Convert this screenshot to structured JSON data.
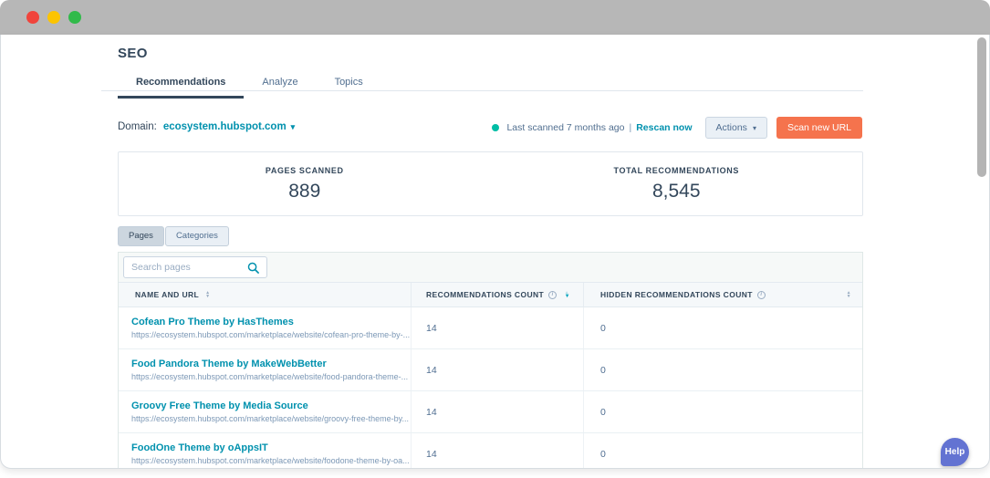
{
  "window_chrome": {
    "traffic_lights": [
      "close",
      "minimize",
      "zoom"
    ]
  },
  "header": {
    "title": "SEO",
    "tabs": [
      {
        "label": "Recommendations",
        "active": true
      },
      {
        "label": "Analyze",
        "active": false
      },
      {
        "label": "Topics",
        "active": false
      }
    ]
  },
  "toolbar": {
    "domain_label": "Domain:",
    "domain_value": "ecosystem.hubspot.com",
    "last_scanned": "Last scanned 7 months ago",
    "separator": "|",
    "rescan_label": "Rescan now",
    "actions_label": "Actions",
    "scan_new_url_label": "Scan new URL"
  },
  "stats": [
    {
      "label": "PAGES SCANNED",
      "value": "889"
    },
    {
      "label": "TOTAL RECOMMENDATIONS",
      "value": "8,545"
    }
  ],
  "view_toggle": [
    {
      "label": "Pages",
      "active": true
    },
    {
      "label": "Categories",
      "active": false
    }
  ],
  "search": {
    "placeholder": "Search pages"
  },
  "table": {
    "columns": [
      {
        "label": "NAME AND URL",
        "info": false,
        "sort": "inactive"
      },
      {
        "label": "RECOMMENDATIONS COUNT",
        "info": true,
        "sort": "desc"
      },
      {
        "label": "HIDDEN RECOMMENDATIONS COUNT",
        "info": true,
        "sort": "inactive"
      }
    ],
    "rows": [
      {
        "name": "Cofean Pro Theme by HasThemes",
        "url": "https://ecosystem.hubspot.com/marketplace/website/cofean-pro-theme-by-...",
        "recommendations": "14",
        "hidden": "0"
      },
      {
        "name": "Food Pandora Theme by MakeWebBetter",
        "url": "https://ecosystem.hubspot.com/marketplace/website/food-pandora-theme-...",
        "recommendations": "14",
        "hidden": "0"
      },
      {
        "name": "Groovy Free Theme by Media Source",
        "url": "https://ecosystem.hubspot.com/marketplace/website/groovy-free-theme-by...",
        "recommendations": "14",
        "hidden": "0"
      },
      {
        "name": "FoodOne Theme by oAppsIT",
        "url": "https://ecosystem.hubspot.com/marketplace/website/foodone-theme-by-oa...",
        "recommendations": "14",
        "hidden": "0"
      }
    ]
  },
  "help": {
    "label": "Help"
  },
  "icons": {
    "caret_down": "▾",
    "sort_up": "▲",
    "sort_down": "▼",
    "info": "i"
  },
  "colors": {
    "accent_teal": "#0091ae",
    "primary_orange": "#f5734d",
    "text_navy": "#33475b",
    "status_dot_teal": "#00bda5",
    "help_indigo": "#6373d2",
    "titlebar_gray": "#b7b7b7"
  }
}
